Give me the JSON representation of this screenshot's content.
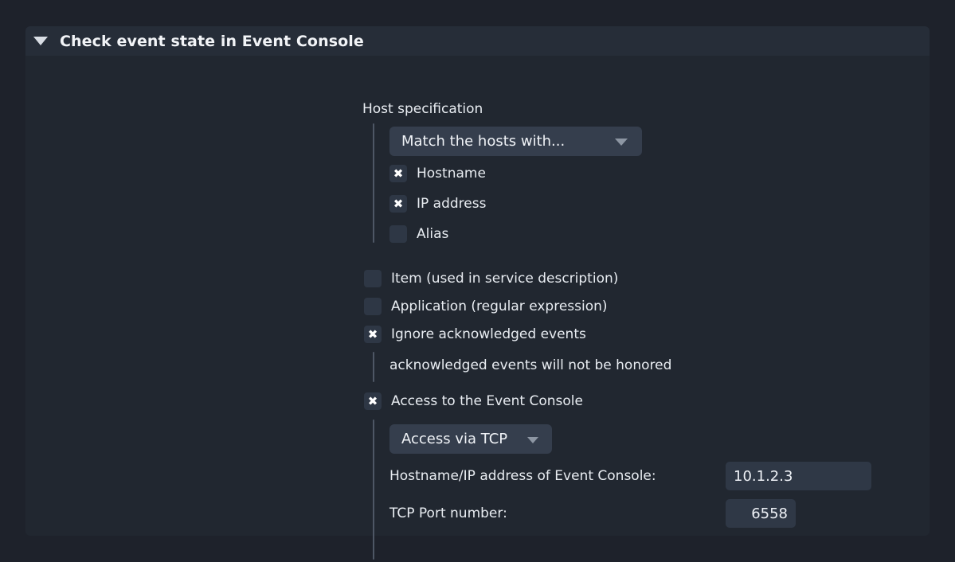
{
  "panel": {
    "title": "Check event state in Event Console",
    "collapse_icon": "triangle-down-icon",
    "expanded": true
  },
  "host_specification": {
    "label": "Host specification",
    "dropdown": {
      "value": "Match the hosts with...",
      "chevron_icon": "chevron-down-icon"
    },
    "options": [
      {
        "label": "Hostname",
        "checked": true,
        "icon": "checkbox-checked-icon"
      },
      {
        "label": "IP address",
        "checked": true,
        "icon": "checkbox-checked-icon"
      },
      {
        "label": "Alias",
        "checked": false,
        "icon": "checkbox-unchecked-icon"
      }
    ]
  },
  "options": [
    {
      "label": "Item (used in service description)",
      "checked": false,
      "icon": "checkbox-unchecked-icon"
    },
    {
      "label": "Application (regular expression)",
      "checked": false,
      "icon": "checkbox-unchecked-icon"
    },
    {
      "label": "Ignore acknowledged events",
      "checked": true,
      "icon": "checkbox-checked-icon"
    }
  ],
  "ignore_note": "acknowledged events will not be honored",
  "access": {
    "label": "Access to the Event Console",
    "checked": true,
    "icon": "checkbox-checked-icon",
    "dropdown": {
      "value": "Access via TCP",
      "chevron_icon": "chevron-down-icon"
    },
    "host_field": {
      "label": "Hostname/IP address of Event Console:",
      "value": "10.1.2.3",
      "placeholder": ""
    },
    "port_field": {
      "label": "TCP Port number:",
      "value": "6558",
      "placeholder": ""
    }
  },
  "colors": {
    "page_background": "#1e222b",
    "panel_background": "#212730",
    "panel_header": "#262d38",
    "control_background": "#353e4d",
    "input_background": "#2f3846",
    "checkbox_background": "#2e3745",
    "text": "#e9edf2",
    "indent_bar": "#4e5765"
  }
}
